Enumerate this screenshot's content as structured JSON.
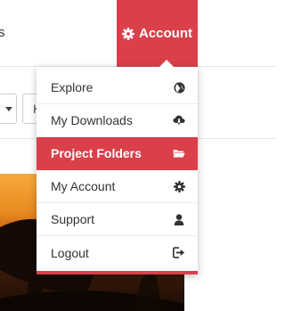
{
  "header": {
    "nav_partial_text": "s",
    "account": {
      "label": "Account",
      "icon": "gear-icon"
    }
  },
  "toolbar": {
    "field_partial_text": "K"
  },
  "dropdown": {
    "items": [
      {
        "label": "Explore",
        "icon": "globe-icon",
        "active": false
      },
      {
        "label": "My Downloads",
        "icon": "cloud-download-icon",
        "active": false
      },
      {
        "label": "Project Folders",
        "icon": "folder-open-icon",
        "active": true
      },
      {
        "label": "My Account",
        "icon": "gear-icon",
        "active": false
      },
      {
        "label": "Support",
        "icon": "user-icon",
        "active": false
      },
      {
        "label": "Logout",
        "icon": "logout-icon",
        "active": false
      }
    ]
  },
  "colors": {
    "accent": "#d9404a",
    "text": "#333333",
    "divider": "#ececec"
  }
}
